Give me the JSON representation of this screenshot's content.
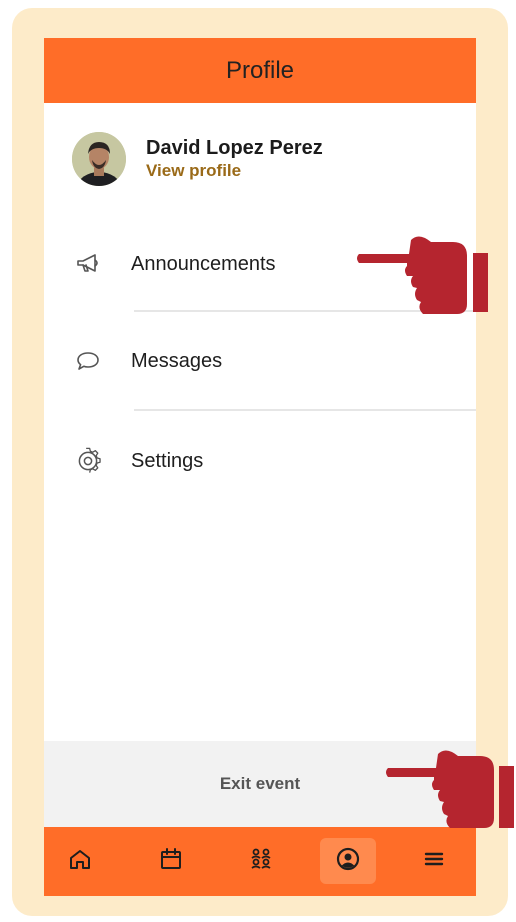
{
  "header": {
    "title": "Profile"
  },
  "profile": {
    "name": "David Lopez Perez",
    "link_label": "View profile"
  },
  "menu": {
    "items": [
      {
        "label": "Announcements",
        "icon": "megaphone-icon"
      },
      {
        "label": "Messages",
        "icon": "chat-bubble-icon"
      },
      {
        "label": "Settings",
        "icon": "gear-icon"
      }
    ]
  },
  "exit": {
    "label": "Exit event"
  },
  "bottom_nav": {
    "items": [
      {
        "icon": "home-icon"
      },
      {
        "icon": "calendar-icon"
      },
      {
        "icon": "people-icon"
      },
      {
        "icon": "profile-circle-icon",
        "active": true
      },
      {
        "icon": "menu-icon"
      }
    ]
  },
  "colors": {
    "accent": "#ff6d28",
    "frame": "#fdebc9",
    "link": "#9a6a18",
    "pointer": "#b5252f"
  }
}
